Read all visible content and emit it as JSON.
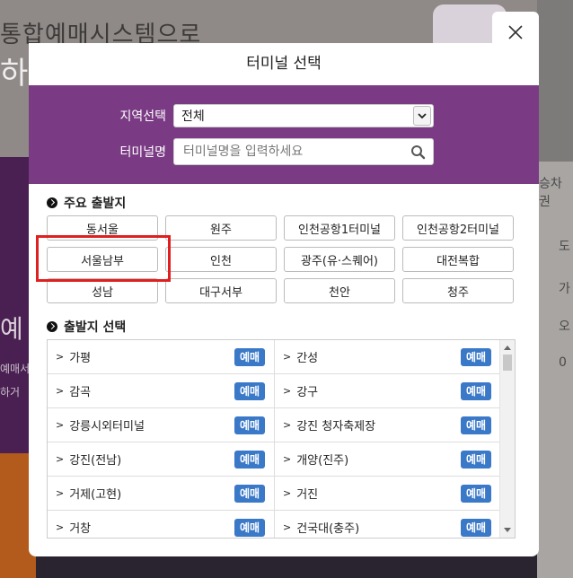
{
  "background": {
    "headline": "통합예매시스템으로",
    "headline2": "하",
    "side_text": "예",
    "side_small1": "예매서",
    "side_small2": "하거",
    "right_labels": [
      "승차권",
      "도",
      "가",
      "오",
      "0"
    ]
  },
  "modal": {
    "title": "터미널 선택",
    "region_label": "지역선택",
    "region_value": "전체",
    "terminal_label": "터미널명",
    "terminal_placeholder": "터미널명을 입력하세요"
  },
  "major": {
    "title": "주요 출발지",
    "items": [
      "동서울",
      "원주",
      "인천공항1터미널",
      "인천공항2터미널",
      "서울남부",
      "인천",
      "광주(유·스퀘어)",
      "대전복합",
      "성남",
      "대구서부",
      "천안",
      "청주"
    ]
  },
  "list": {
    "title": "출발지 선택",
    "badge": "예매",
    "rows": [
      [
        "가평",
        "간성"
      ],
      [
        "감곡",
        "강구"
      ],
      [
        "강릉시외터미널",
        "강진 청자축제장"
      ],
      [
        "강진(전남)",
        "개양(진주)"
      ],
      [
        "거제(고현)",
        "거진"
      ],
      [
        "거창",
        "건국대(충주)"
      ]
    ]
  }
}
